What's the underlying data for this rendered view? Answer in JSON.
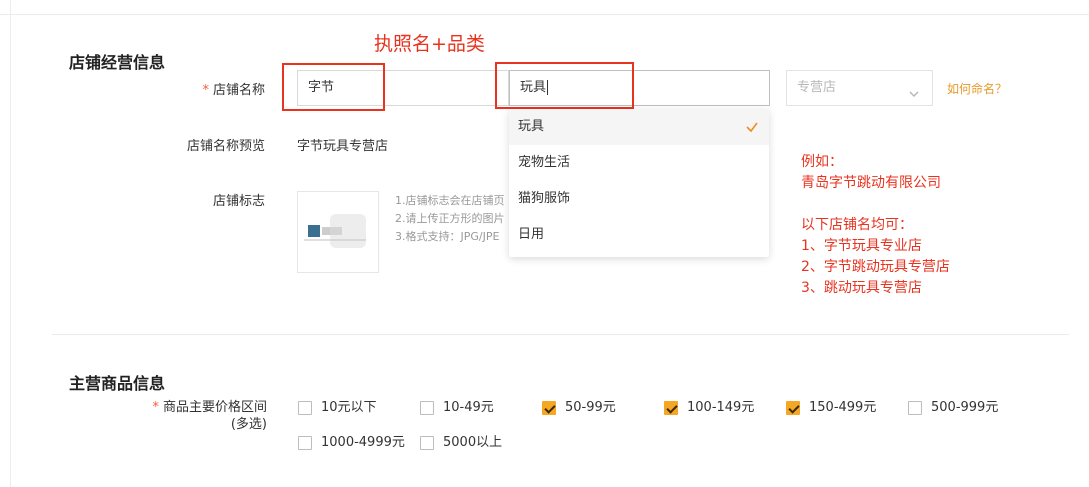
{
  "annotations": {
    "top_note": "执照名+品类",
    "example_title": "例如：",
    "example_company": "青岛字节跳动有限公司",
    "following_title": "以下店铺名均可：",
    "examples": [
      "1、字节玩具专业店",
      "2、字节跳动玩具专营店",
      "3、跳动玩具专营店"
    ]
  },
  "shop_section": {
    "title": "店铺经营信息",
    "required_mark": "*",
    "name_label": "店铺名称",
    "name_input_value": "字节",
    "category_input_value": "玩具",
    "type_select_value": "专营店",
    "how_to_name_link": "如何命名？",
    "preview_label": "店铺名称预览",
    "preview_value": "字节玩具专营店",
    "logo_label": "店铺标志",
    "logo_hints": [
      "1.店铺标志会在店铺页",
      "2.请上传正方形的图片",
      "3.格式支持：JPG/JPE"
    ]
  },
  "dropdown": {
    "items": [
      "玩具",
      "宠物生活",
      "猫狗服饰",
      "日用"
    ],
    "selected_index": 0
  },
  "goods_section": {
    "title": "主营商品信息",
    "required_mark": "*",
    "price_label": "商品主要价格区间",
    "price_label_sub": "(多选)",
    "price_options": [
      {
        "label": "10元以下",
        "checked": false
      },
      {
        "label": "10-49元",
        "checked": false
      },
      {
        "label": "50-99元",
        "checked": true
      },
      {
        "label": "100-149元",
        "checked": true
      },
      {
        "label": "150-499元",
        "checked": true
      },
      {
        "label": "500-999元",
        "checked": false
      },
      {
        "label": "1000-4999元",
        "checked": false
      },
      {
        "label": "5000以上",
        "checked": false
      }
    ]
  },
  "colors": {
    "annotation_red": "#e8331f",
    "accent_orange": "#f5a623",
    "link_orange": "#e59a2b"
  }
}
